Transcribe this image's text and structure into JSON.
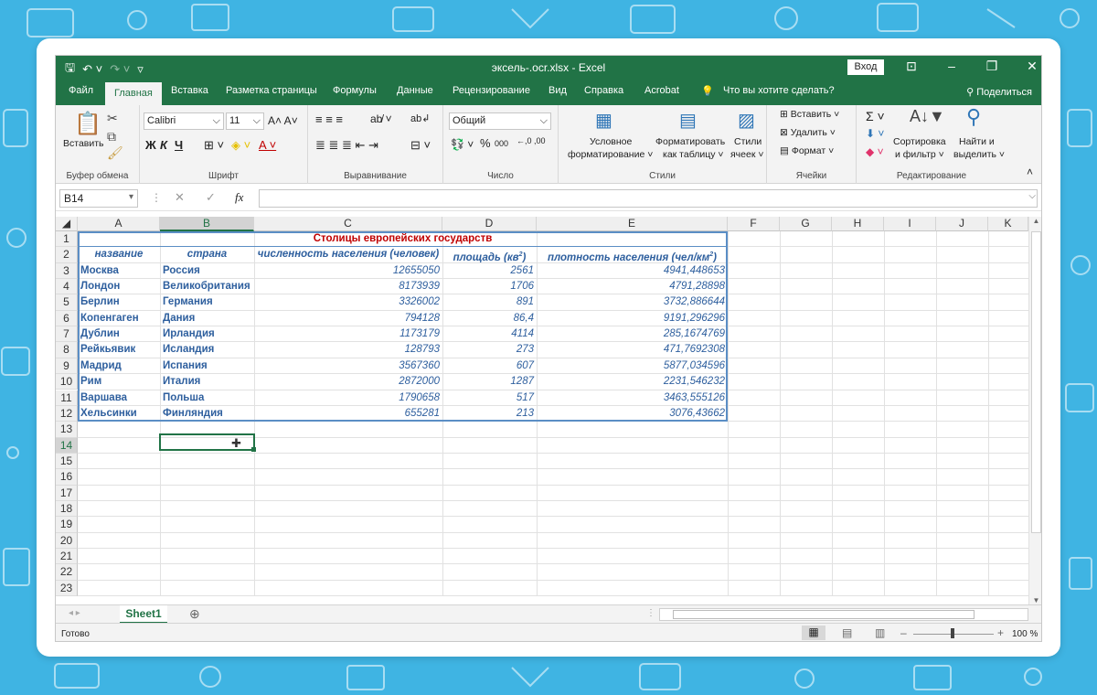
{
  "window": {
    "title": "эксель-.ocr.xlsx  -  Excel",
    "signin_label": "Вход"
  },
  "tabs": [
    "Файл",
    "Главная",
    "Вставка",
    "Разметка страницы",
    "Формулы",
    "Данные",
    "Рецензирование",
    "Вид",
    "Справка",
    "Acrobat"
  ],
  "tellme": "Что вы хотите сделать?",
  "share": "Поделиться",
  "ribbon": {
    "paste": "Вставить",
    "clipboard": "Буфер обмена",
    "font_name": "Calibri",
    "font_size": "11",
    "bold": "Ж",
    "italic": "К",
    "underline": "Ч",
    "font_group": "Шрифт",
    "align_group": "Выравнивание",
    "number_format": "Общий",
    "percent": "%",
    "thousands": "000",
    "number_group": "Число",
    "cond_format_1": "Условное",
    "cond_format_2": "форматирование ˅",
    "format_table_1": "Форматировать",
    "format_table_2": "как таблицу ˅",
    "styles_1": "Стили",
    "styles_2": "ячеек ˅",
    "styles_group": "Стили",
    "insert": "Вставить",
    "delete": "Удалить",
    "format": "Формат",
    "cells_group": "Ячейки",
    "sum": "Σ",
    "sort_1": "Сортировка",
    "sort_2": "и фильтр ˅",
    "find_1": "Найти и",
    "find_2": "выделить ˅",
    "edit_group": "Редактирование"
  },
  "formula_bar": {
    "name_box": "B14",
    "fx": "fx",
    "content": ""
  },
  "columns": [
    "A",
    "B",
    "C",
    "D",
    "E",
    "F",
    "G",
    "H",
    "I",
    "J",
    "K"
  ],
  "rows": [
    "1",
    "2",
    "3",
    "4",
    "5",
    "6",
    "7",
    "8",
    "9",
    "10",
    "11",
    "12",
    "13",
    "14",
    "15",
    "16",
    "17",
    "18",
    "19",
    "20",
    "21",
    "22",
    "23"
  ],
  "table": {
    "title": "Столицы европейских государств",
    "headers": [
      "название",
      "страна",
      "численность населения (человек)",
      "площадь (кв",
      "плотность населения (чел/км"
    ],
    "sup": "2",
    "close_paren": ")",
    "rows": [
      [
        "Москва",
        "Россия",
        "12655050",
        "2561",
        "4941,448653"
      ],
      [
        "Лондон",
        "Великобритания",
        "8173939",
        "1706",
        "4791,28898"
      ],
      [
        "Берлин",
        "Германия",
        "3326002",
        "891",
        "3732,886644"
      ],
      [
        "Копенгаген",
        "Дания",
        "794128",
        "86,4",
        "9191,296296"
      ],
      [
        "Дублин",
        "Ирландия",
        "1173179",
        "4114",
        "285,1674769"
      ],
      [
        "Рейкьявик",
        "Исландия",
        "128793",
        "273",
        "471,7692308"
      ],
      [
        "Мадрид",
        "Испания",
        "3567360",
        "607",
        "5877,034596"
      ],
      [
        "Рим",
        "Италия",
        "2872000",
        "1287",
        "2231,546232"
      ],
      [
        "Варшава",
        "Польша",
        "1790658",
        "517",
        "3463,555126"
      ],
      [
        "Хельсинки",
        "Финляндия",
        "655281",
        "213",
        "3076,43662"
      ]
    ]
  },
  "sheet": {
    "tab": "Sheet1"
  },
  "status": {
    "ready": "Готово",
    "zoom": "100 %"
  }
}
